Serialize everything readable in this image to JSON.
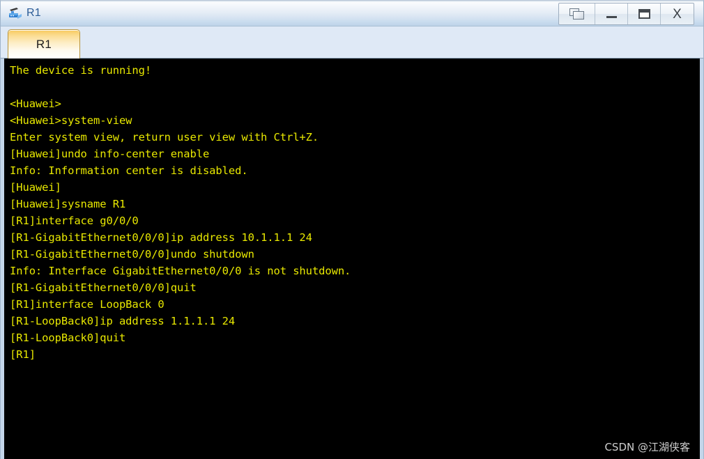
{
  "window": {
    "title": "R1",
    "icon": "router-icon",
    "controls": [
      {
        "name": "restore-window-button",
        "label": "",
        "glyph": "restore-windows-icon"
      },
      {
        "name": "minimize-button",
        "label": "",
        "glyph": "minimize-icon"
      },
      {
        "name": "maximize-button",
        "label": "",
        "glyph": "maximize-icon"
      },
      {
        "name": "close-button",
        "label": "X",
        "glyph": "close-icon"
      }
    ]
  },
  "tabs": [
    {
      "label": "R1",
      "active": true
    }
  ],
  "terminal": {
    "background": "#000000",
    "foreground": "#e8e800",
    "lines": [
      "The device is running!",
      "",
      "<Huawei>",
      "<Huawei>system-view",
      "Enter system view, return user view with Ctrl+Z.",
      "[Huawei]undo info-center enable",
      "Info: Information center is disabled.",
      "[Huawei]",
      "[Huawei]sysname R1",
      "[R1]interface g0/0/0",
      "[R1-GigabitEthernet0/0/0]ip address 10.1.1.1 24",
      "[R1-GigabitEthernet0/0/0]undo shutdown",
      "Info: Interface GigabitEthernet0/0/0 is not shutdown.",
      "[R1-GigabitEthernet0/0/0]quit",
      "[R1]interface LoopBack 0",
      "[R1-LoopBack0]ip address 1.1.1.1 24",
      "[R1-LoopBack0]quit",
      "[R1]"
    ]
  },
  "watermark": {
    "text": "CSDN @江湖侠客"
  }
}
